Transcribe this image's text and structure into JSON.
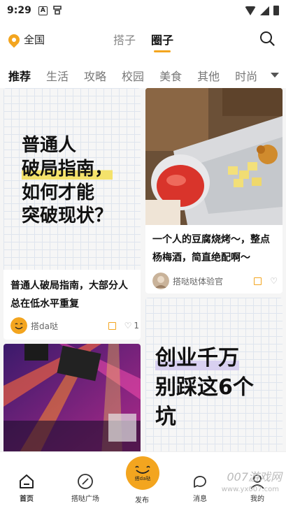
{
  "status_bar": {
    "time": "9:29",
    "a_icon_text": "A"
  },
  "header": {
    "location": "全国",
    "tabs": [
      {
        "label": "搭子"
      },
      {
        "label": "圈子"
      }
    ]
  },
  "categories": [
    "推荐",
    "生活",
    "攻略",
    "校园",
    "美食",
    "其他",
    "时尚"
  ],
  "feed": {
    "card1": {
      "cover_lines": [
        "普通人",
        "破局指南，",
        "如何才能",
        "突破现状？"
      ],
      "title_line1": "普通人破局指南，大部分人",
      "title_line2": "总在低水平重复",
      "author": "搭da哒",
      "likes": "1"
    },
    "card2": {
      "title_line1": "一个人的豆腐烧烤～，整点",
      "title_line2": "杨梅酒，简直绝配啊～",
      "author": "搭哒哒体验官"
    },
    "card3": {
      "cover_lines": [
        "创业千万",
        "别踩这6个",
        "坑"
      ]
    }
  },
  "bottom_nav": {
    "home": "首页",
    "plaza": "搭哒广场",
    "publish": "发布",
    "publish_logo_text": "搭da哒",
    "messages": "消息",
    "mine": "我的"
  },
  "watermark": {
    "main": "007游戏网",
    "sub": "www.yx007.com"
  },
  "colors": {
    "accent": "#f3a51f"
  }
}
